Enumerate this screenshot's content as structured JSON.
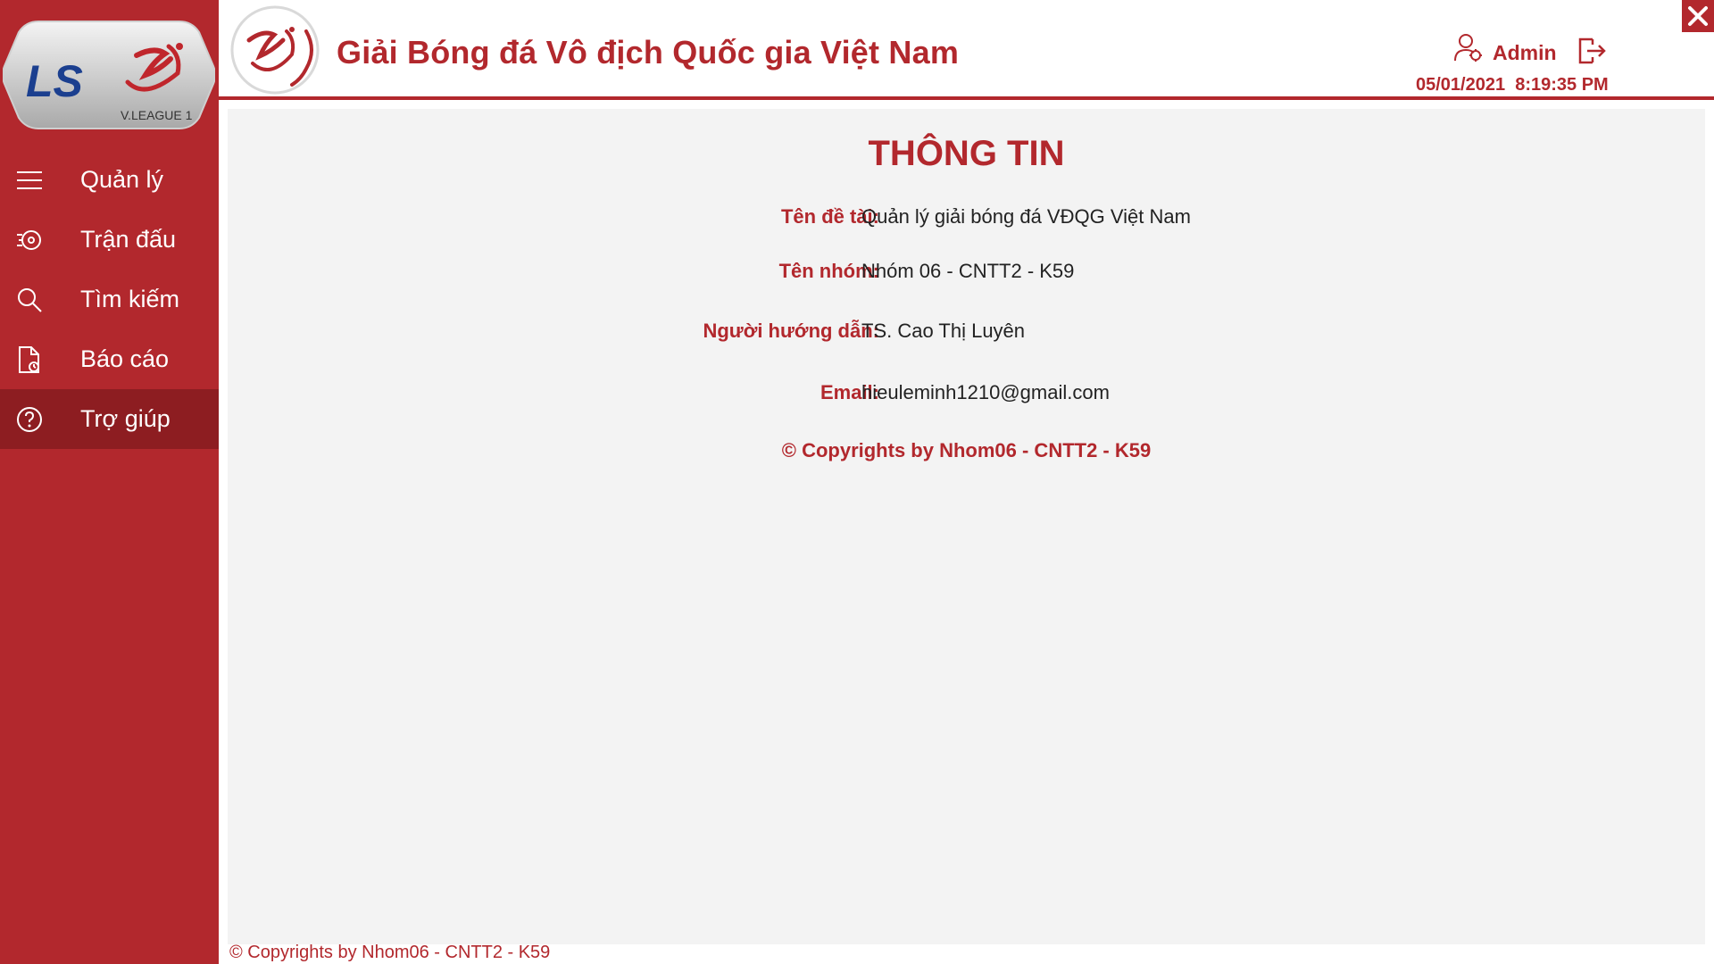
{
  "header": {
    "title": "Giải Bóng đá Vô địch Quốc gia Việt Nam",
    "user_name": "Admin",
    "datetime": "05/01/2021  8:19:35 PM"
  },
  "logo": {
    "brand_text": "LS",
    "league_text": "V.LEAGUE 1"
  },
  "sidebar": {
    "items": [
      {
        "label": "Quản lý",
        "icon": "hamburger-menu-icon"
      },
      {
        "label": "Trận đấu",
        "icon": "match-whistle-icon"
      },
      {
        "label": "Tìm kiếm",
        "icon": "search-icon"
      },
      {
        "label": "Báo cáo",
        "icon": "report-document-icon"
      },
      {
        "label": "Trợ giúp",
        "icon": "help-question-icon",
        "active": true
      }
    ]
  },
  "content": {
    "title": "THÔNG TIN",
    "rows": [
      {
        "label": "Tên đề tài:",
        "value": "Quản lý giải bóng đá VĐQG Việt Nam"
      },
      {
        "label": "Tên nhóm:",
        "value": "Nhóm 06 - CNTT2 - K59"
      },
      {
        "label": "Người hướng dẫn:",
        "value": "TS. Cao Thị Luyên"
      },
      {
        "label": "Email:",
        "value": "hieuleminh1210@gmail.com"
      }
    ],
    "copyright": "© Copyrights by Nhom06 - CNTT2 - K59"
  },
  "footer": {
    "copyright": "© Copyrights by Nhom06 - CNTT2 - K59"
  },
  "colors": {
    "brand_red": "#b2282d",
    "active_red": "#8d1d21",
    "panel_bg": "#f3f3f3"
  }
}
